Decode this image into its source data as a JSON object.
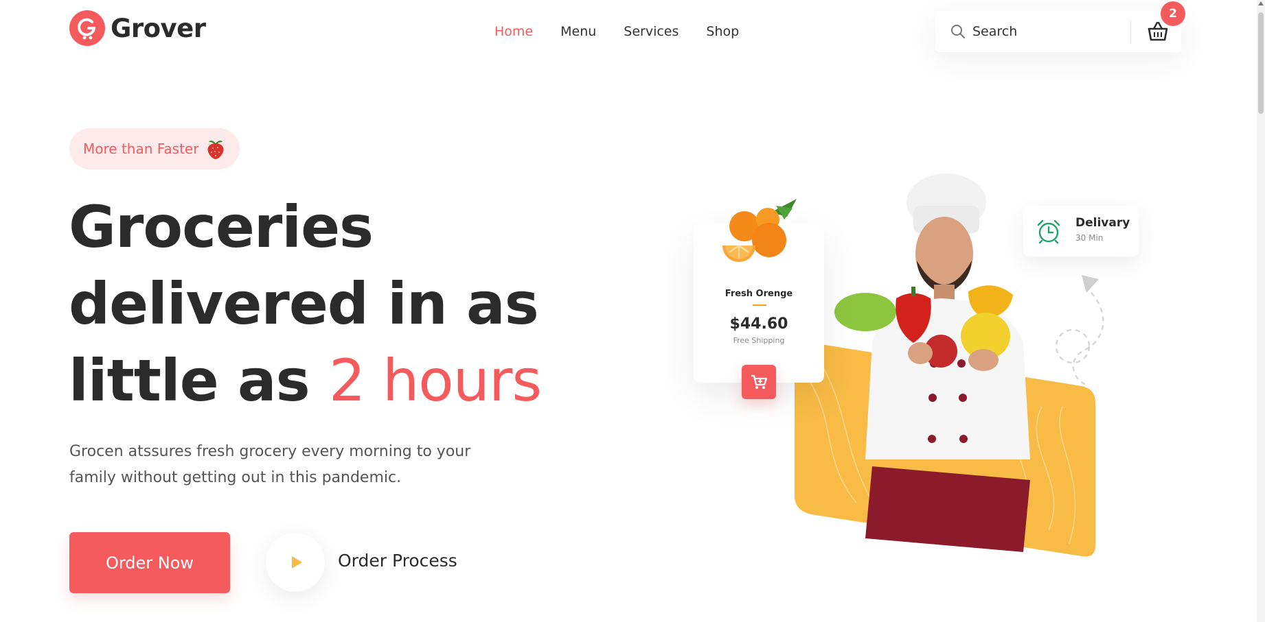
{
  "header": {
    "brand": "Grover",
    "nav": [
      {
        "label": "Home",
        "active": true
      },
      {
        "label": "Menu",
        "active": false
      },
      {
        "label": "Services",
        "active": false
      },
      {
        "label": "Shop",
        "active": false
      }
    ],
    "search": {
      "placeholder": "Search",
      "icon": "search-icon"
    },
    "cart": {
      "icon": "basket-icon",
      "count": "2"
    }
  },
  "hero": {
    "tag": "More than Faster",
    "headline": {
      "line1": "Groceries",
      "line2": "delivered in as",
      "line3_prefix": "little as ",
      "line3_accent": "2 hours"
    },
    "description": "Grocen atssures fresh grocery every morning to your family without getting out in this pandemic.",
    "order_button": "Order Now",
    "process_label": "Order Process"
  },
  "product_card": {
    "name": "Fresh Orenge",
    "price": "$44.60",
    "shipping": "Free Shipping"
  },
  "delivery_card": {
    "title": "Delivary",
    "time": "30 Min",
    "icon": "alarm-clock-icon"
  },
  "colors": {
    "accent": "#f55a5d",
    "accent_light": "#fdeaea",
    "yellow": "#f8bb45",
    "green": "#1ea36b",
    "text": "#2b2b2b"
  }
}
